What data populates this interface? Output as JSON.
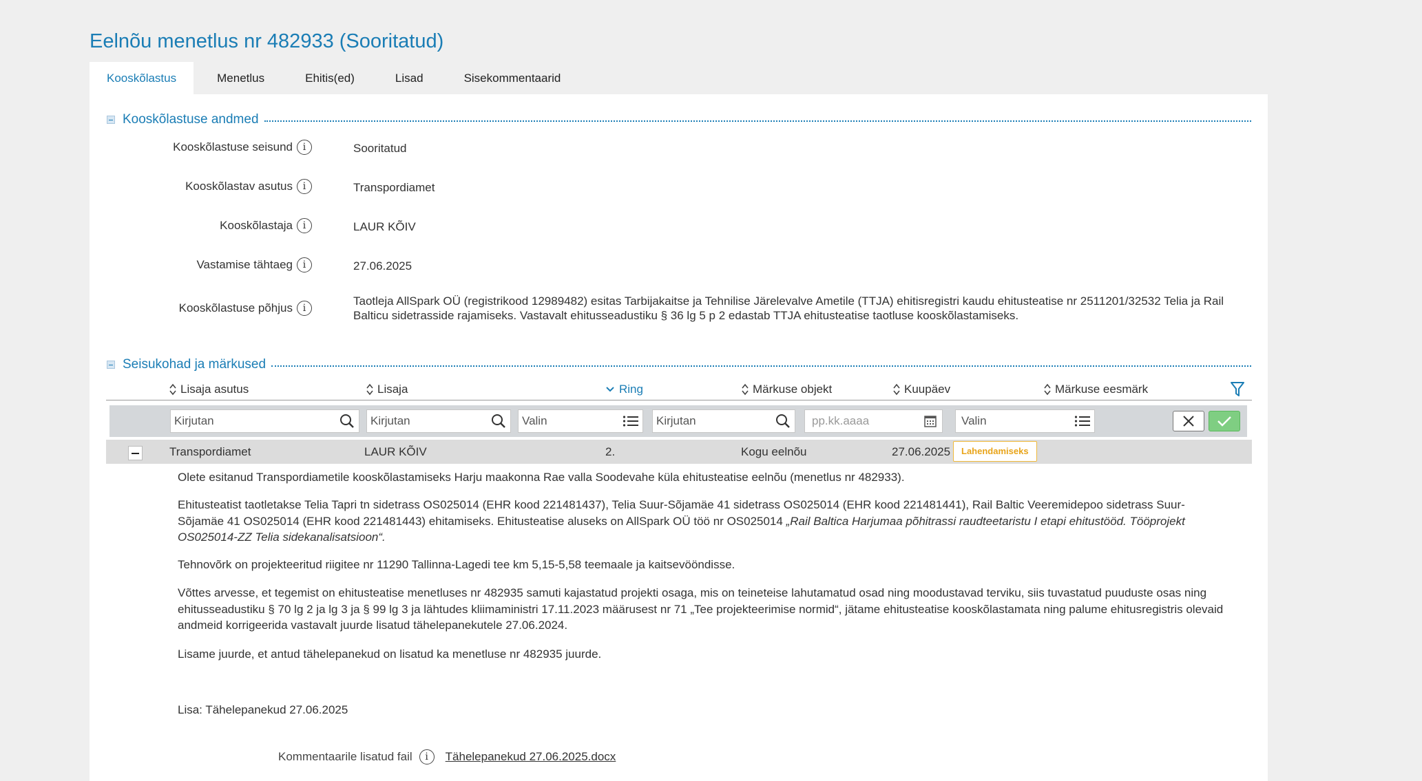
{
  "page": {
    "title": "Eelnõu menetlus nr 482933 (Sooritatud)"
  },
  "tabs": [
    {
      "label": "Kooskõlastus",
      "active": true
    },
    {
      "label": "Menetlus",
      "active": false
    },
    {
      "label": "Ehitis(ed)",
      "active": false
    },
    {
      "label": "Lisad",
      "active": false
    },
    {
      "label": "Sisekommentaarid",
      "active": false
    }
  ],
  "section1": {
    "title": "Kooskõlastuse andmed",
    "fields": [
      {
        "label": "Kooskõlastuse seisund",
        "value": "Sooritatud"
      },
      {
        "label": "Kooskõlastav asutus",
        "value": "Transpordiamet"
      },
      {
        "label": "Kooskõlastaja",
        "value": "LAUR KÕIV"
      },
      {
        "label": "Vastamise tähtaeg",
        "value": "27.06.2025"
      },
      {
        "label": "Kooskõlastuse põhjus",
        "value": "Taotleja AllSpark OÜ (registrikood 12989482) esitas Tarbijakaitse ja Tehnilise Järelevalve Ametile (TTJA) ehitisregistri kaudu ehitusteatise nr 2511201/32532 Telia ja Rail Balticu sidetrasside rajamiseks. Vastavalt ehitusseadustiku § 36 lg 5 p 2 edastab TTJA ehitusteatise taotluse kooskõlastamiseks."
      }
    ]
  },
  "section2": {
    "title": "Seisukohad ja märkused",
    "columns": [
      {
        "label": "Lisaja asutus",
        "sorted": false
      },
      {
        "label": "Lisaja",
        "sorted": false
      },
      {
        "label": "Ring",
        "sorted": true
      },
      {
        "label": "Märkuse objekt",
        "sorted": false
      },
      {
        "label": "Kuupäev",
        "sorted": false
      },
      {
        "label": "Märkuse eesmärk",
        "sorted": false
      }
    ],
    "filters": {
      "asutus_placeholder": "Kirjutan",
      "lisaja_placeholder": "Kirjutan",
      "ring_placeholder": "Valin",
      "objekt_placeholder": "Kirjutan",
      "kuupaev_placeholder": "pp.kk.aaaa",
      "eesmark_placeholder": "Valin"
    },
    "row": {
      "asutus": "Transpordiamet",
      "lisaja": "LAUR KÕIV",
      "ring": "2.",
      "objekt": "Kogu eelnõu",
      "kuupaev": "27.06.2025",
      "eesmark": "Lahendamiseks"
    },
    "comment": {
      "p1": "Olete esitanud Transpordiametile kooskõlastamiseks Harju maakonna Rae valla Soodevahe küla ehitusteatise eelnõu (menetlus nr 482933).",
      "p2a": "Ehitusteatist taotletakse Telia Tapri tn sidetrass OS025014 (EHR kood 221481437), Telia Suur-Sõjamäe 41 sidetrass OS025014 (EHR kood 221481441), Rail Baltic Veeremidepoo sidetrass Suur-Sõjamäe 41 OS025014 (EHR kood 221481443) ehitamiseks. Ehitusteatise aluseks on AllSpark OÜ töö nr OS025014 ",
      "p2b": "„Rail Baltica Harjumaa põhitrassi raudteetaristu I etapi ehitustööd. Tööprojekt OS025014-ZZ Telia sidekanalisatsioon“.",
      "p3": "Tehnovõrk on projekteeritud riigitee nr 11290 Tallinna-Lagedi tee km 5,15-5,58 teemaale ja kaitsevööndisse.",
      "p4": "Võttes arvesse, et tegemist on ehitusteatise menetluses nr 482935 samuti kajastatud projekti osaga, mis on teineteise lahutamatud osad ning moodustavad terviku, siis tuvastatud puuduste osas ning ehitusseadustiku § 70 lg 2 ja lg 3 ja § 99 lg 3 ja lähtudes kliimaministri 17.11.2023 määrusest nr 71 „Tee projekteerimise normid“, jätame ehitusteatise kooskõlastamata ning palume ehitusregistris olevaid andmeid korrigeerida vastavalt juurde lisatud tähelepanekutele 27.06.2024.",
      "p5": "Lisame juurde, et antud tähelepanekud on lisatud ka menetluse nr 482935 juurde.",
      "p6": "Lisa: Tähelepanekud 27.06.2025"
    },
    "attachment": {
      "label": "Kommentaarile lisatud fail",
      "file": "Tähelepanekud 27.06.2025.docx"
    }
  },
  "colors": {
    "accent": "#1a7db5",
    "badge": "#f0b93a",
    "ok": "#7fce82"
  }
}
